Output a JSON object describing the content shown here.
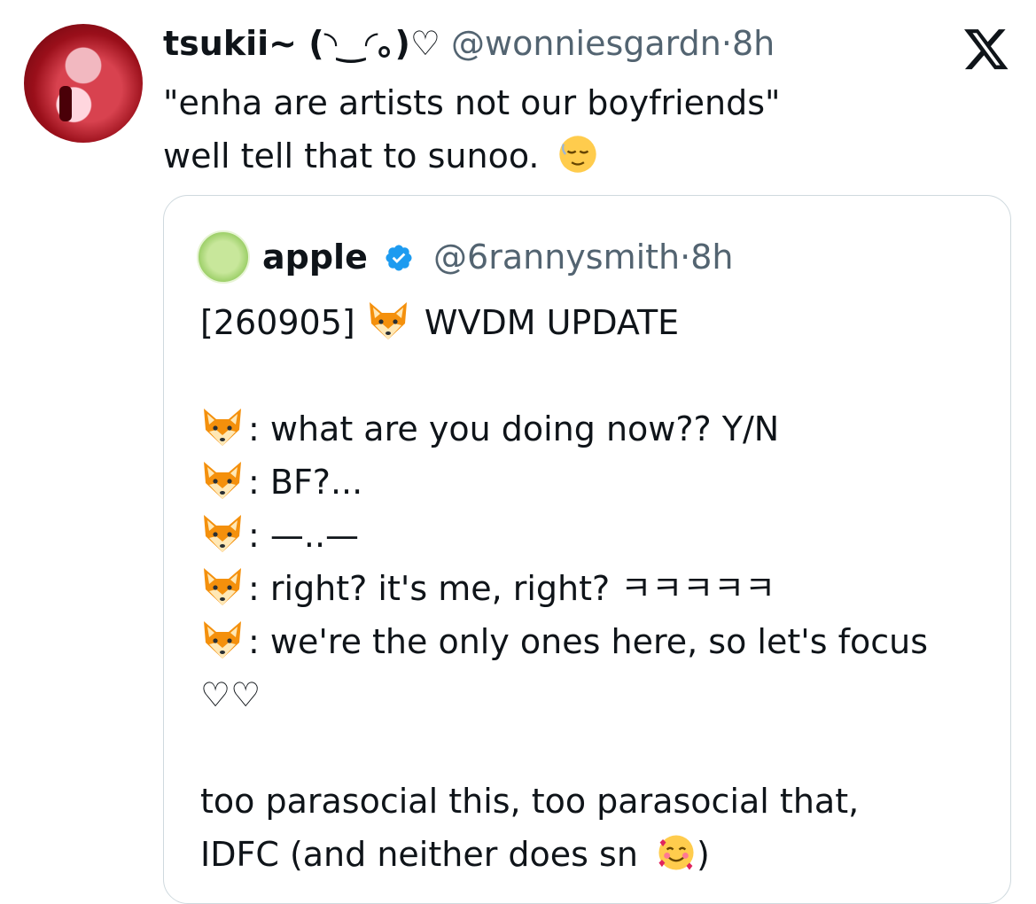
{
  "tweet": {
    "display_name": "tsukii~ (◝‿◜｡)♡",
    "handle": "@wonniesgardn",
    "separator": "·",
    "time": "8h",
    "lines": [
      "\"enha are artists not our boyfriends\"",
      "well tell that to sunoo."
    ],
    "emoji": "relieved-face-icon"
  },
  "quote": {
    "display_name": "apple",
    "handle": "@6rannysmith",
    "separator": "·",
    "time": "8h",
    "title_prefix": "[260905]",
    "title_suffix": "WVDM UPDATE",
    "dialogue": [
      ": what are you doing now?? Y/N",
      ": BF?...",
      ": —..—",
      ": right? it's me, right? ㅋㅋㅋㅋㅋ",
      ": we're the only ones here, so let's focus"
    ],
    "hearts": "♡♡",
    "closing": [
      "too parasocial this, too parasocial that,",
      "IDFC (and neither does sn",
      ")"
    ]
  },
  "icons": {
    "fox": "fox-face-icon",
    "verified": "verified-badge-icon",
    "x": "x-logo-icon",
    "smile_hearts": "smiling-face-with-hearts-icon"
  },
  "colors": {
    "text": "#0f1419",
    "muted": "#536471",
    "border": "#cfd9de",
    "verified_blue": "#1d9bf0"
  }
}
